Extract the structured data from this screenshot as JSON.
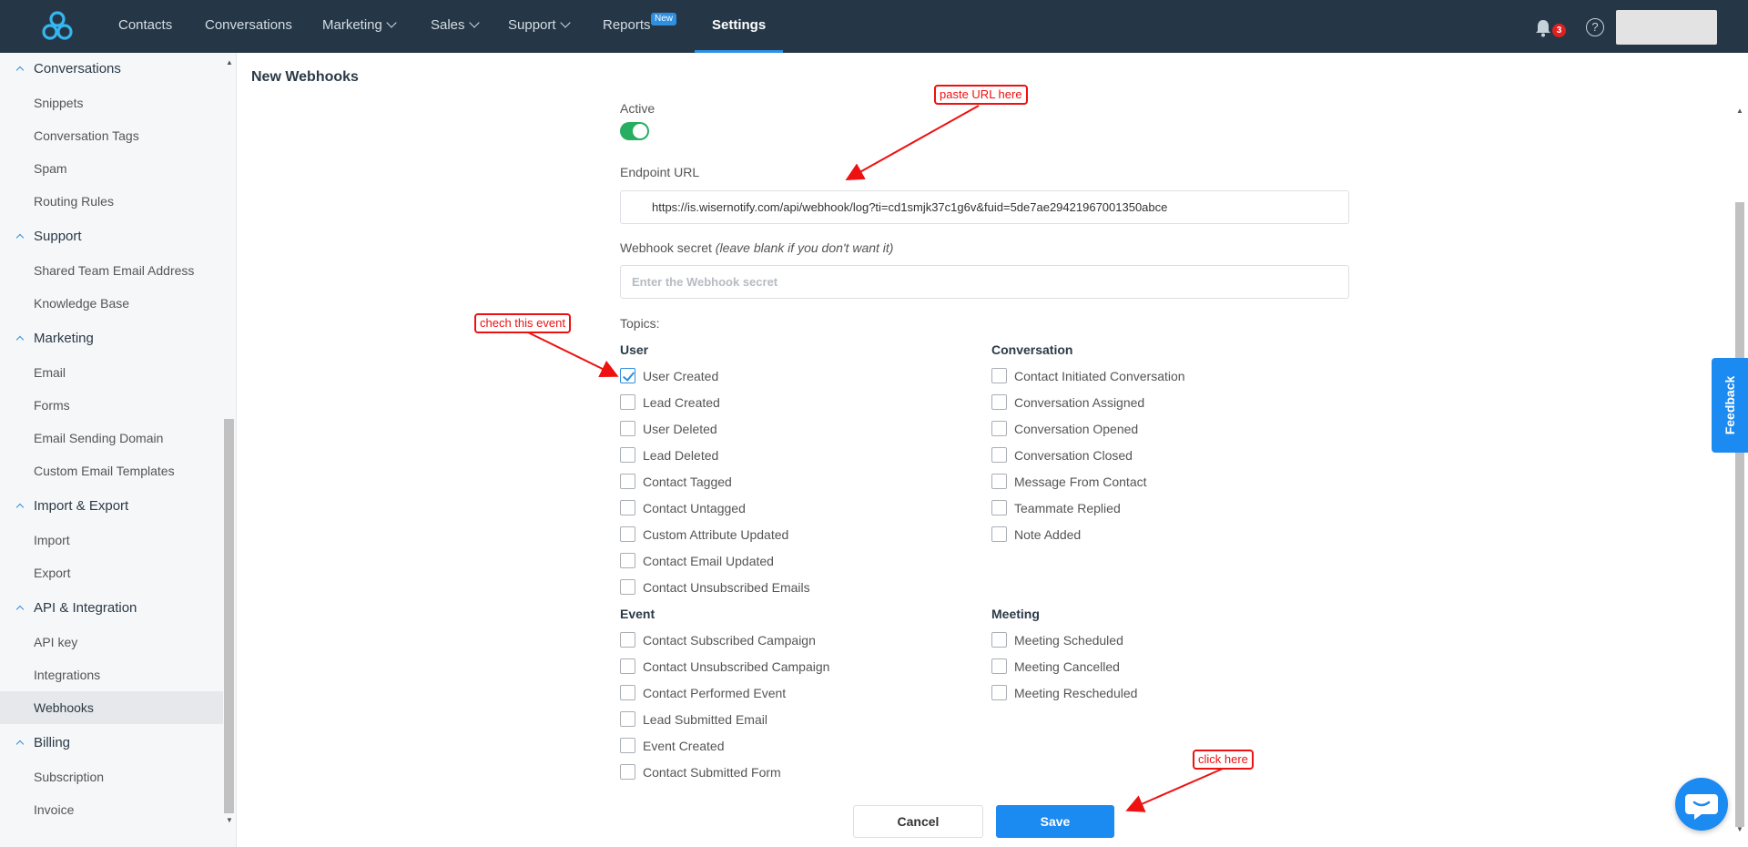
{
  "nav": {
    "items": [
      {
        "label": "Contacts"
      },
      {
        "label": "Conversations"
      },
      {
        "label": "Marketing"
      },
      {
        "label": "Sales"
      },
      {
        "label": "Support"
      },
      {
        "label": "Reports"
      },
      {
        "label": "Settings"
      }
    ],
    "reports_badge": "New",
    "notification_count": "3",
    "help_glyph": "?"
  },
  "sidebar": {
    "groups": [
      {
        "label": "Conversations",
        "items": [
          "Snippets",
          "Conversation Tags",
          "Spam",
          "Routing Rules"
        ]
      },
      {
        "label": "Support",
        "items": [
          "Shared Team Email Address",
          "Knowledge Base"
        ]
      },
      {
        "label": "Marketing",
        "items": [
          "Email",
          "Forms",
          "Email Sending Domain",
          "Custom Email Templates"
        ]
      },
      {
        "label": "Import & Export",
        "items": [
          "Import",
          "Export"
        ]
      },
      {
        "label": "API & Integration",
        "items": [
          "API key",
          "Integrations",
          "Webhooks"
        ]
      },
      {
        "label": "Billing",
        "items": [
          "Subscription",
          "Invoice"
        ]
      }
    ],
    "selected": "Webhooks"
  },
  "page": {
    "title": "New Webhooks",
    "active_label": "Active",
    "active": true,
    "endpoint_label": "Endpoint URL",
    "endpoint_value": "https://is.wisernotify.com/api/webhook/log?ti=cd1smjk37c1g6v&fuid=5de7ae29421967001350abce",
    "secret_label": "Webhook secret",
    "secret_hint": "(leave blank if you don't want it)",
    "secret_placeholder": "Enter the Webhook secret",
    "topics_label": "Topics:"
  },
  "topics": {
    "user": {
      "heading": "User",
      "items": [
        {
          "label": "User Created",
          "checked": true
        },
        {
          "label": "Lead Created",
          "checked": false
        },
        {
          "label": "User Deleted",
          "checked": false
        },
        {
          "label": "Lead Deleted",
          "checked": false
        },
        {
          "label": "Contact Tagged",
          "checked": false
        },
        {
          "label": "Contact Untagged",
          "checked": false
        },
        {
          "label": "Custom Attribute Updated",
          "checked": false
        },
        {
          "label": "Contact Email Updated",
          "checked": false
        },
        {
          "label": "Contact Unsubscribed Emails",
          "checked": false
        }
      ]
    },
    "conversation": {
      "heading": "Conversation",
      "items": [
        {
          "label": "Contact Initiated Conversation",
          "checked": false
        },
        {
          "label": "Conversation Assigned",
          "checked": false
        },
        {
          "label": "Conversation Opened",
          "checked": false
        },
        {
          "label": "Conversation Closed",
          "checked": false
        },
        {
          "label": "Message From Contact",
          "checked": false
        },
        {
          "label": "Teammate Replied",
          "checked": false
        },
        {
          "label": "Note Added",
          "checked": false
        }
      ]
    },
    "event": {
      "heading": "Event",
      "items": [
        {
          "label": "Contact Subscribed Campaign",
          "checked": false
        },
        {
          "label": "Contact Unsubscribed Campaign",
          "checked": false
        },
        {
          "label": "Contact Performed Event",
          "checked": false
        },
        {
          "label": "Lead Submitted Email",
          "checked": false
        },
        {
          "label": "Event Created",
          "checked": false
        },
        {
          "label": "Contact Submitted Form",
          "checked": false
        }
      ]
    },
    "meeting": {
      "heading": "Meeting",
      "items": [
        {
          "label": "Meeting Scheduled",
          "checked": false
        },
        {
          "label": "Meeting Cancelled",
          "checked": false
        },
        {
          "label": "Meeting Rescheduled",
          "checked": false
        }
      ]
    }
  },
  "buttons": {
    "cancel": "Cancel",
    "save": "Save"
  },
  "annotations": {
    "paste_url": "paste URL here",
    "check_event": "chech this event",
    "click_here": "click here"
  },
  "feedback_label": "Feedback",
  "colors": {
    "topbar": "#253746",
    "accent": "#1b8af1",
    "toggle_on": "#27ae60",
    "annotation": "#ee1111"
  },
  "icons": [
    "logo-icon",
    "bell-icon",
    "help-icon",
    "chat-icon",
    "chevron-down-icon",
    "caret-up-icon",
    "check-icon"
  ]
}
